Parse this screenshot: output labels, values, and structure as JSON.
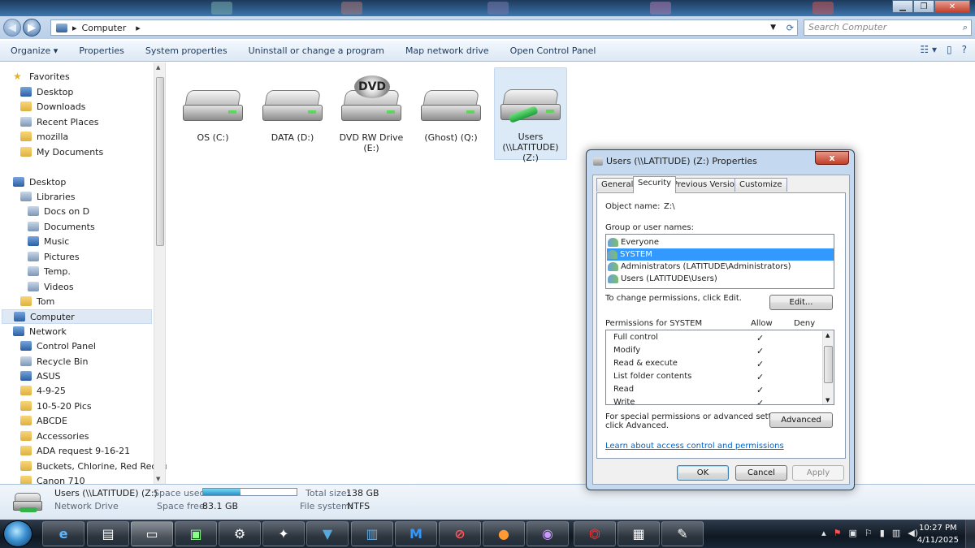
{
  "address": {
    "root": "Computer",
    "search_placeholder": "Search Computer"
  },
  "toolbar": {
    "organize": "Organize ▾",
    "properties": "Properties",
    "system_properties": "System properties",
    "uninstall": "Uninstall or change a program",
    "map_drive": "Map network drive",
    "control_panel": "Open Control Panel"
  },
  "nav": {
    "favorites": [
      "Favorites",
      "Desktop",
      "Downloads",
      "Recent Places",
      "mozilla",
      "My Documents"
    ],
    "tree": [
      "Desktop",
      "Libraries",
      "Docs on D",
      "Documents",
      "Music",
      "Pictures",
      "Temp.",
      "Videos",
      "Tom",
      "Computer",
      "Network",
      "Control Panel",
      "Recycle Bin",
      "ASUS",
      "4-9-25",
      "10-5-20 Pics",
      "ABCDE",
      "Accessories",
      "ADA request 9-16-21",
      "Buckets, Chlorine, Red Rectang",
      "Canon 710"
    ]
  },
  "drives": [
    {
      "label": "OS (C:)"
    },
    {
      "label": "DATA (D:)"
    },
    {
      "label": "DVD RW Drive (E:)",
      "badge": "DVD"
    },
    {
      "label": "(Ghost) (Q:)"
    },
    {
      "label": "Users (\\\\LATITUDE) (Z:)"
    }
  ],
  "details": {
    "name": "Users (\\\\LATITUDE) (Z:)",
    "type": "Network Drive",
    "used_label": "Space used:",
    "used_fraction": 0.4,
    "free_label": "Space free:",
    "free_value": "83.1 GB",
    "total_label": "Total size:",
    "total_value": "138 GB",
    "fs_label": "File system:",
    "fs_value": "NTFS"
  },
  "dialog": {
    "title": "Users (\\\\LATITUDE) (Z:) Properties",
    "close": "x",
    "tabs": [
      "General",
      "Security",
      "Previous Versions",
      "Customize"
    ],
    "object_label": "Object name:",
    "object_value": "Z:\\",
    "group_label": "Group or user names:",
    "users": [
      "Everyone",
      "SYSTEM",
      "Administrators (LATITUDE\\Administrators)",
      "Users (LATITUDE\\Users)"
    ],
    "change_text": "To change permissions, click Edit.",
    "edit": "Edit...",
    "perm_label": "Permissions for SYSTEM",
    "allow": "Allow",
    "deny": "Deny",
    "permissions": [
      "Full control",
      "Modify",
      "Read & execute",
      "List folder contents",
      "Read",
      "Write"
    ],
    "special_text_1": "For special permissions or advanced settings,",
    "special_text_2": "click Advanced.",
    "advanced": "Advanced",
    "link": "Learn about access control and permissions",
    "ok": "OK",
    "cancel": "Cancel",
    "apply": "Apply"
  },
  "taskbar": {
    "time": "10:27 PM",
    "date": "4/11/2025"
  }
}
